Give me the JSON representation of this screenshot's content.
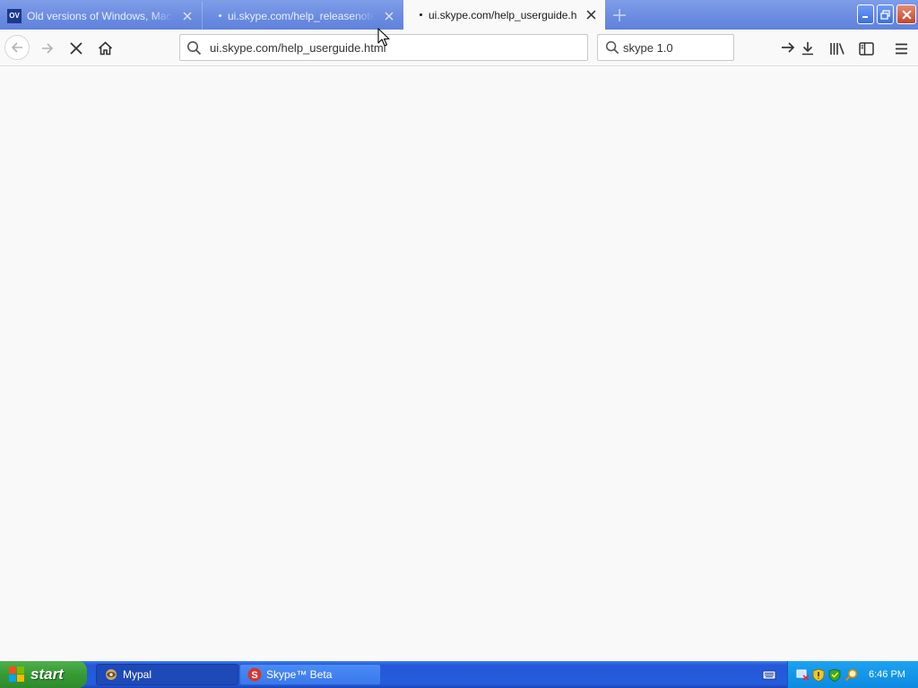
{
  "browser": {
    "tabs": [
      {
        "title": "Old versions of Windows, Mac and Linux software",
        "favicon": "OV",
        "active": false,
        "loading": false
      },
      {
        "title": "ui.skype.com/help_releasenotes.html",
        "active": false,
        "loading": true
      },
      {
        "title": "ui.skype.com/help_userguide.html",
        "active": true,
        "loading": true
      }
    ],
    "address": {
      "value": "ui.skype.com/help_userguide.html"
    },
    "search": {
      "value": "skype 1.0"
    }
  },
  "taskbar": {
    "start_label": "start",
    "tasks": [
      {
        "label": "Mypal",
        "icon": "mypal-icon"
      },
      {
        "label": "Skype™ Beta",
        "icon": "skype-icon"
      }
    ],
    "clock": "6:46 PM"
  },
  "colors": {
    "tab_strip": "#6a8be0",
    "taskbar": "#245ddb",
    "start_button": "#379a35",
    "tray": "#0e8ae0"
  }
}
